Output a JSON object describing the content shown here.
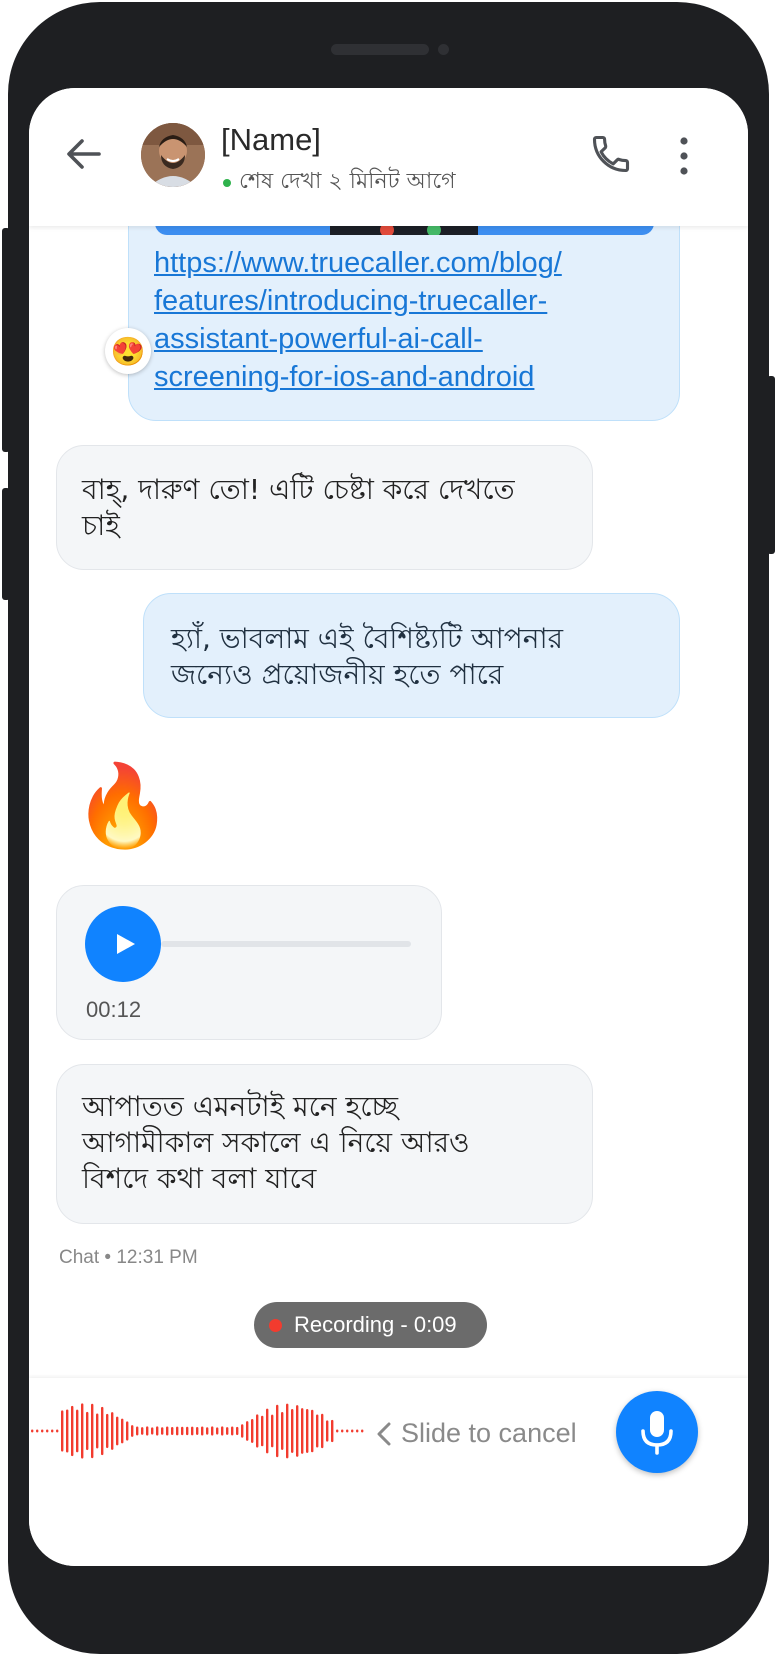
{
  "header": {
    "contact_name": "[Name]",
    "last_seen": "শেষ দেখা ২ মিনিট আগে"
  },
  "messages": {
    "link_url": "https://www.truecaller.com/blog/features/introducing-truecaller-assistant-powerful-ai-call-screening-for-ios-and-android",
    "link_lines": [
      "https://www.truecaller.com/blog/",
      "features/introducing-truecaller-",
      "assistant-powerful-ai-call-",
      "screening-for-ios-and-android"
    ],
    "link_reaction": "😍",
    "incoming_1": [
      "বাহ্, দারুণ তো! এটি চেষ্টা করে দেখতে",
      "চাই"
    ],
    "outgoing_1": [
      "হ্যাঁ, ভাবলাম এই বৈশিষ্ট্যটি আপনার",
      "জন্যেও প্রয়োজনীয় হতে পারে"
    ],
    "emoji_message": "🔥",
    "voice_duration": "00:12",
    "voice_progress": 0,
    "incoming_2": [
      "আপাতত এমনটাই মনে হচ্ছে",
      "আগামীকাল সকালে এ নিয়ে আরও",
      "বিশদে কথা বলা যাবে"
    ]
  },
  "chat_meta": "Chat • 12:31 PM",
  "recording": {
    "label": "Recording - 0:09"
  },
  "input": {
    "slide_to_cancel": "Slide to cancel"
  },
  "colors": {
    "accent": "#1083ff",
    "waveform": "#f23b2e",
    "link": "#1877d6",
    "online": "#2fb24c"
  }
}
